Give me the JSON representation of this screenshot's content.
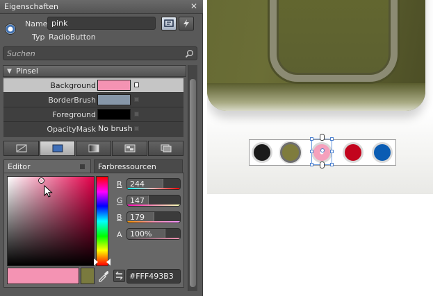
{
  "panel": {
    "title": "Eigenschaften",
    "close_icon": "close-icon",
    "name_label": "Name",
    "name_value": "pink",
    "type_label": "Typ",
    "type_value": "RadioButton",
    "search_placeholder": "Suchen"
  },
  "brush_section": {
    "title": "Pinsel",
    "properties": [
      {
        "name": "Background",
        "color": "#F493B3"
      },
      {
        "name": "BorderBrush",
        "color": "#8797A9"
      },
      {
        "name": "Foreground",
        "color": "#000000"
      },
      {
        "name": "OpacityMask",
        "text": "No brush"
      }
    ],
    "brush_types": [
      "no-brush-icon",
      "solid-color-brush-icon",
      "gradient-brush-icon",
      "tile-brush-icon",
      "brush-resources-icon"
    ]
  },
  "editor": {
    "tab_editor": "Editor",
    "tab_resources": "Farbressourcen",
    "channels": [
      {
        "label": "R",
        "value": "244",
        "fraction": 0.957,
        "grad": "linear-gradient(90deg,#00ffff,#ffb3b3,#ff0000)"
      },
      {
        "label": "G",
        "value": "147",
        "fraction": 0.576,
        "grad": "linear-gradient(90deg,#ff00b3,#f493b3,#f4ffb3)"
      },
      {
        "label": "B",
        "value": "179",
        "fraction": 0.702,
        "grad": "linear-gradient(90deg,#f49300,#f493b3,#f493ff)"
      },
      {
        "label": "A",
        "value": "100%",
        "fraction": 1.0,
        "grad": "linear-gradient(90deg,#555,#f493b3)"
      }
    ],
    "hex_value": "#FFF493B3",
    "new_color": "#F493B3",
    "old_color": "#7A7A3E"
  },
  "artboard": {
    "swatches": [
      "#1a1a1a",
      "#7f7c3d",
      "#f5a0bc",
      "#c2041d",
      "#0a5cb3"
    ],
    "checked_index": 1,
    "selected_index": 2
  }
}
